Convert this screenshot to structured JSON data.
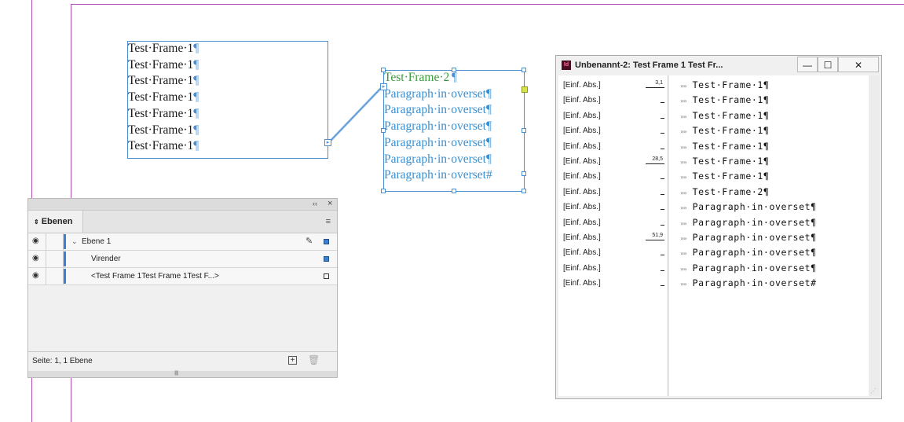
{
  "frame1": {
    "lines": [
      "Test·Frame·1",
      "Test·Frame·1",
      "Test·Frame·1",
      "Test·Frame·1",
      "Test·Frame·1",
      "Test·Frame·1",
      "Test·Frame·1"
    ],
    "pilcrow": "¶",
    "text_color": "#1a1a1a"
  },
  "frame2": {
    "first_line": "Test·Frame·2",
    "first_line_color": "#3a9a3a",
    "lines": [
      "Paragraph·in·overset",
      "Paragraph·in·overset",
      "Paragraph·in·overset",
      "Paragraph·in·overset",
      "Paragraph·in·overset",
      "Paragraph·in·overset"
    ],
    "line_endings": [
      "¶",
      "¶",
      "¶",
      "¶",
      "¶",
      "#"
    ],
    "text_color": "#3a8fd0"
  },
  "layers_panel": {
    "tab_label": "Ebenen",
    "tab_icon": "updown-arrows-icon",
    "collapse_glyph": "‹‹",
    "close_glyph": "×",
    "menu_glyph": "≡",
    "rows": [
      {
        "name": "Ebene 1",
        "swatch_color": "#3d7fd0"
      },
      {
        "name": "Virender",
        "swatch_color": "#3d7fd0"
      },
      {
        "name": "<Test Frame 1Test Frame 1Test F...>",
        "swatch_color": "#ffffff"
      }
    ],
    "footer_status": "Seite: 1, 1 Ebene",
    "accent_color": "#3d7fd0"
  },
  "story_editor": {
    "title": "Unbenannt-2: Test Frame 1 Test Fr...",
    "app_icon_label": "Id",
    "minimize_glyph": "—",
    "maximize_glyph": "☐",
    "close_glyph": "✕",
    "rows": [
      {
        "style": "[Einf. Abs.]",
        "depth": "3,1",
        "text": "Test·Frame·1¶"
      },
      {
        "style": "[Einf. Abs.]",
        "depth": "",
        "text": "Test·Frame·1¶"
      },
      {
        "style": "[Einf. Abs.]",
        "depth": "",
        "text": "Test·Frame·1¶"
      },
      {
        "style": "[Einf. Abs.]",
        "depth": "",
        "text": "Test·Frame·1¶"
      },
      {
        "style": "[Einf. Abs.]",
        "depth": "",
        "text": "Test·Frame·1¶"
      },
      {
        "style": "[Einf. Abs.]",
        "depth": "28,5",
        "text": "Test·Frame·1¶"
      },
      {
        "style": "[Einf. Abs.]",
        "depth": "",
        "text": "Test·Frame·1¶"
      },
      {
        "style": "[Einf. Abs.]",
        "depth": "",
        "text": "Test·Frame·2¶"
      },
      {
        "style": "[Einf. Abs.]",
        "depth": "",
        "text": "Paragraph·in·overset¶"
      },
      {
        "style": "[Einf. Abs.]",
        "depth": "",
        "text": "Paragraph·in·overset¶"
      },
      {
        "style": "[Einf. Abs.]",
        "depth": "51,9",
        "text": "Paragraph·in·overset¶"
      },
      {
        "style": "[Einf. Abs.]",
        "depth": "",
        "text": "Paragraph·in·overset¶"
      },
      {
        "style": "[Einf. Abs.]",
        "depth": "",
        "text": "Paragraph·in·overset¶"
      },
      {
        "style": "[Einf. Abs.]",
        "depth": "",
        "text": "Paragraph·in·overset#"
      }
    ],
    "row_chevron": "»»"
  }
}
